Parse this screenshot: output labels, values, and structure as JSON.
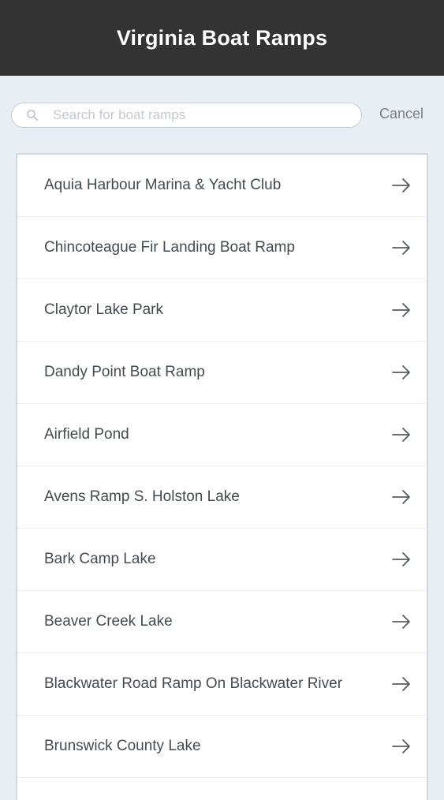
{
  "header": {
    "title": "Virginia Boat Ramps"
  },
  "search": {
    "placeholder": "Search for boat ramps",
    "value": "",
    "icon": "search-icon",
    "cancel_label": "Cancel"
  },
  "list": {
    "items": [
      {
        "label": "Aquia Harbour Marina & Yacht Club",
        "icon": "arrow-right-icon"
      },
      {
        "label": "Chincoteague Fir Landing Boat Ramp",
        "icon": "arrow-right-icon"
      },
      {
        "label": "Claytor Lake Park",
        "icon": "arrow-right-icon"
      },
      {
        "label": "Dandy Point Boat Ramp",
        "icon": "arrow-right-icon"
      },
      {
        "label": "Airfield Pond",
        "icon": "arrow-right-icon"
      },
      {
        "label": "Avens Ramp S. Holston Lake",
        "icon": "arrow-right-icon"
      },
      {
        "label": "Bark Camp Lake",
        "icon": "arrow-right-icon"
      },
      {
        "label": "Beaver Creek Lake",
        "icon": "arrow-right-icon"
      },
      {
        "label": "Blackwater Road Ramp On Blackwater River",
        "icon": "arrow-right-icon"
      },
      {
        "label": "Brunswick County Lake",
        "icon": "arrow-right-icon"
      }
    ]
  },
  "colors": {
    "header_bg": "#333333",
    "page_bg": "#e9eef5",
    "text": "#444a52",
    "muted": "#7a7f87"
  }
}
